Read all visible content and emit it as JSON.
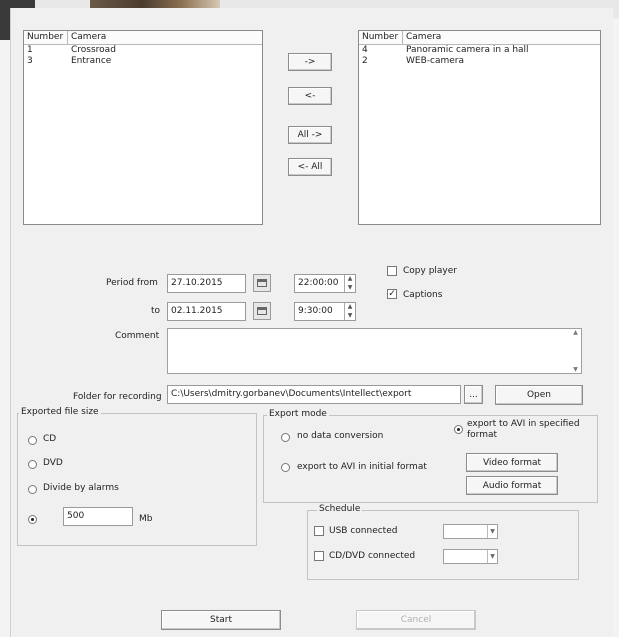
{
  "source_list": {
    "headers": [
      "Number",
      "Camera"
    ],
    "rows": [
      {
        "number": "1",
        "camera": "Crossroad"
      },
      {
        "number": "3",
        "camera": "Entrance"
      }
    ]
  },
  "target_list": {
    "headers": [
      "Number",
      "Camera"
    ],
    "rows": [
      {
        "number": "4",
        "camera": "Panoramic camera in a hall"
      },
      {
        "number": "2",
        "camera": "WEB-camera"
      }
    ]
  },
  "transfer_buttons": {
    "add": "->",
    "remove": "<-",
    "add_all": "All ->",
    "remove_all": "<- All"
  },
  "period": {
    "from_label": "Period from",
    "from_date": "27.10.2015",
    "from_time": "22:00:00",
    "to_label": "to",
    "to_date": "02.11.2015",
    "to_time": "9:30:00"
  },
  "options": {
    "copy_player_label": "Copy player",
    "copy_player_checked": false,
    "captions_label": "Captions",
    "captions_checked": true
  },
  "comment": {
    "label": "Comment",
    "value": ""
  },
  "folder": {
    "label": "Folder for recording",
    "path": "C:\\Users\\dmitry.gorbanev\\Documents\\Intellect\\export",
    "browse_label": "...",
    "open_label": "Open"
  },
  "file_size": {
    "title": "Exported file size",
    "options": [
      "CD",
      "DVD",
      "Divide by alarms"
    ],
    "custom_value": "500",
    "unit": "Mb",
    "selected": "custom"
  },
  "export_mode": {
    "title": "Export mode",
    "no_conversion": "no data conversion",
    "avi_initial": "export to AVI in initial format",
    "avi_specified": "export to AVI in specified format",
    "selected": "avi_specified",
    "video_format_label": "Video format",
    "audio_format_label": "Audio format"
  },
  "schedule": {
    "title": "Schedule",
    "usb_label": "USB connected",
    "cd_label": "CD/DVD connected",
    "usb_value": "",
    "cd_value": ""
  },
  "footer": {
    "start_label": "Start",
    "cancel_label": "Cancel"
  }
}
